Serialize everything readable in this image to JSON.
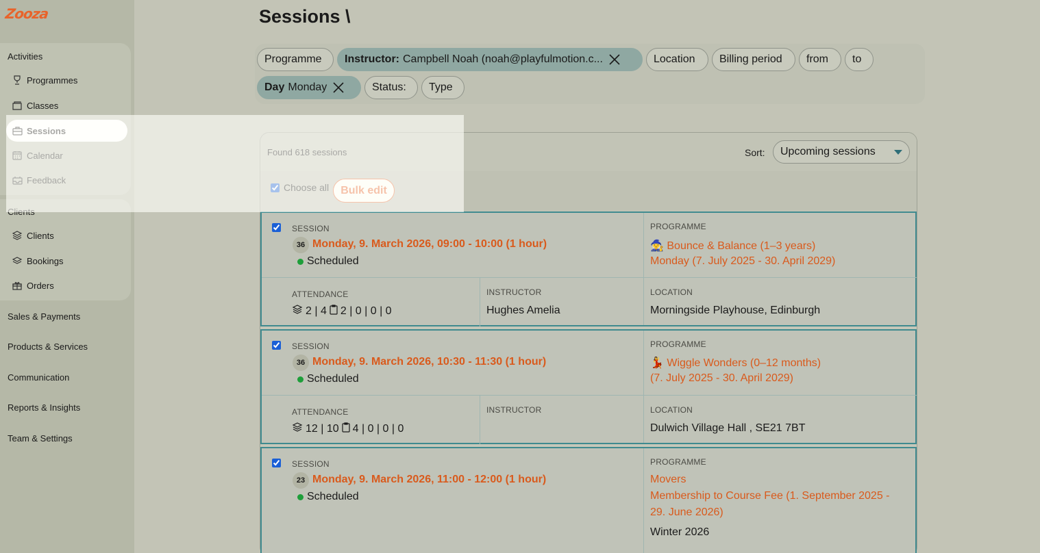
{
  "brand": {
    "logo_text": "Zooza",
    "accent": "#e8632a"
  },
  "sidebar": {
    "groups": [
      {
        "title": "Activities",
        "items": [
          {
            "label": "Programmes",
            "icon": "trophy-icon"
          },
          {
            "label": "Classes",
            "icon": "folder-icon"
          },
          {
            "label": "Sessions",
            "icon": "briefcase-icon",
            "active": true
          },
          {
            "label": "Calendar",
            "icon": "calendar-icon"
          },
          {
            "label": "Feedback",
            "icon": "inbox-icon"
          }
        ]
      },
      {
        "title": "Clients",
        "items": [
          {
            "label": "Clients",
            "icon": "layers-icon"
          },
          {
            "label": "Bookings",
            "icon": "stack-icon"
          },
          {
            "label": "Orders",
            "icon": "gift-icon"
          }
        ]
      }
    ],
    "links": [
      "Sales & Payments",
      "Products & Services",
      "Communication",
      "Reports & Insights",
      "Team & Settings"
    ]
  },
  "page": {
    "title": "Sessions \\"
  },
  "filters": {
    "programme": "Programme",
    "instructor_label": "Instructor:",
    "instructor_value": "Campbell Noah (noah@playfulmotion.c...",
    "location": "Location",
    "billing": "Billing period",
    "from": "from",
    "to": "to",
    "day_label": "Day",
    "day_value": "Monday",
    "status": "Status:",
    "type": "Type"
  },
  "results": {
    "found": "Found 618 sessions",
    "sort_label": "Sort:",
    "sort_value": "Upcoming sessions",
    "choose_all": "Choose all",
    "bulk_edit": "Bulk edit"
  },
  "labels": {
    "session": "SESSION",
    "programme": "PROGRAMME",
    "attendance": "ATTENDANCE",
    "instructor": "INSTRUCTOR",
    "location": "LOCATION"
  },
  "sessions": [
    {
      "badge": "36",
      "date": "Monday, 9. March 2026, 09:00 - 10:00 (1 hour)",
      "status": "Scheduled",
      "programme_line1": "🧙 Bounce & Balance (1–3 years)",
      "programme_line2": "Monday (7. July 2025 - 30. April 2029)",
      "att_a": "2 | 4",
      "att_b": "2 | 0 | 0 | 0",
      "instructor": "Hughes Amelia",
      "location": "Morningside Playhouse, Edinburgh"
    },
    {
      "badge": "36",
      "date": "Monday, 9. March 2026, 10:30 - 11:30 (1 hour)",
      "status": "Scheduled",
      "programme_line1": "💃 Wiggle Wonders (0–12 months)",
      "programme_line2": "(7. July 2025 - 30. April 2029)",
      "att_a": "12 | 10",
      "att_b": "4 | 0 | 0 | 0",
      "instructor": "",
      "location": "Dulwich Village Hall , SE21 7BT"
    },
    {
      "badge": "23",
      "date": "Monday, 9. March 2026, 11:00 - 12:00 (1 hour)",
      "status": "Scheduled",
      "programme_line1": "Movers",
      "programme_line2": "Membership to Course Fee (1. September 2025 -",
      "programme_line3": "29. June 2026)",
      "programme_line4": "Winter 2026"
    }
  ]
}
